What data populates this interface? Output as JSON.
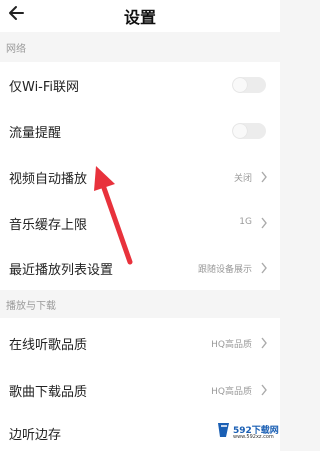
{
  "header": {
    "title": "设置",
    "back_icon": "back-arrow-icon"
  },
  "sections": {
    "network": "网络",
    "play_download": "播放与下载"
  },
  "rows": {
    "wifi_only": {
      "label": "仅Wi-Fi联网",
      "toggle_on": false
    },
    "data_alert": {
      "label": "流量提醒",
      "toggle_on": false
    },
    "autoplay": {
      "label": "视频自动播放",
      "value": "关闭"
    },
    "cache_limit": {
      "label": "音乐缓存上限",
      "value": "1G"
    },
    "recent_list": {
      "label": "最近播放列表设置",
      "value": "跟随设备展示"
    },
    "online_quality": {
      "label": "在线听歌品质",
      "value": "HQ高品质"
    },
    "download_quality": {
      "label": "歌曲下载品质",
      "value": "HQ高品质"
    },
    "listen_cache": {
      "label": "边听边存"
    }
  },
  "annotation": {
    "color": "#e8323c"
  },
  "watermark": {
    "text": "592下载网",
    "sub": "www.592xz.com"
  },
  "colors": {
    "background": "#f5f5f5",
    "row": "#ffffff",
    "muted": "#9a9a9a"
  }
}
